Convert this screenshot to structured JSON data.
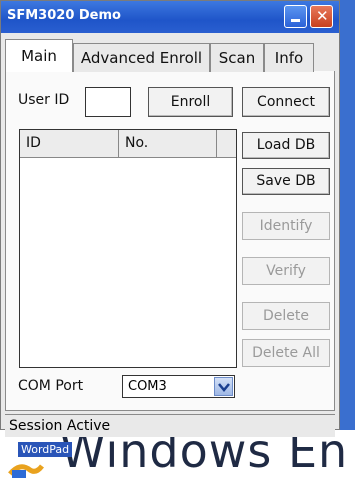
{
  "window": {
    "title": "SFM3020 Demo"
  },
  "tabs": [
    {
      "label": "Main",
      "active": true
    },
    {
      "label": "Advanced Enroll",
      "active": false
    },
    {
      "label": "Scan",
      "active": false
    },
    {
      "label": "Info",
      "active": false
    }
  ],
  "main": {
    "user_id_label": "User ID",
    "user_id_value": "",
    "enroll_label": "Enroll",
    "connect_label": "Connect",
    "list_headers": [
      "ID",
      "No."
    ],
    "buttons": {
      "load_db": "Load DB",
      "save_db": "Save DB",
      "identify": "Identify",
      "verify": "Verify",
      "delete": "Delete",
      "delete_all": "Delete All"
    },
    "com_port_label": "COM Port",
    "com_port_value": "COM3"
  },
  "status": {
    "text": "Session Active"
  },
  "desktop": {
    "wordpad_label": "WordPad",
    "wallpaper_text": "Windows En"
  },
  "colors": {
    "titlebar": "#1f55c9",
    "close": "#c8401f",
    "desktop": "#3a6fcf"
  }
}
